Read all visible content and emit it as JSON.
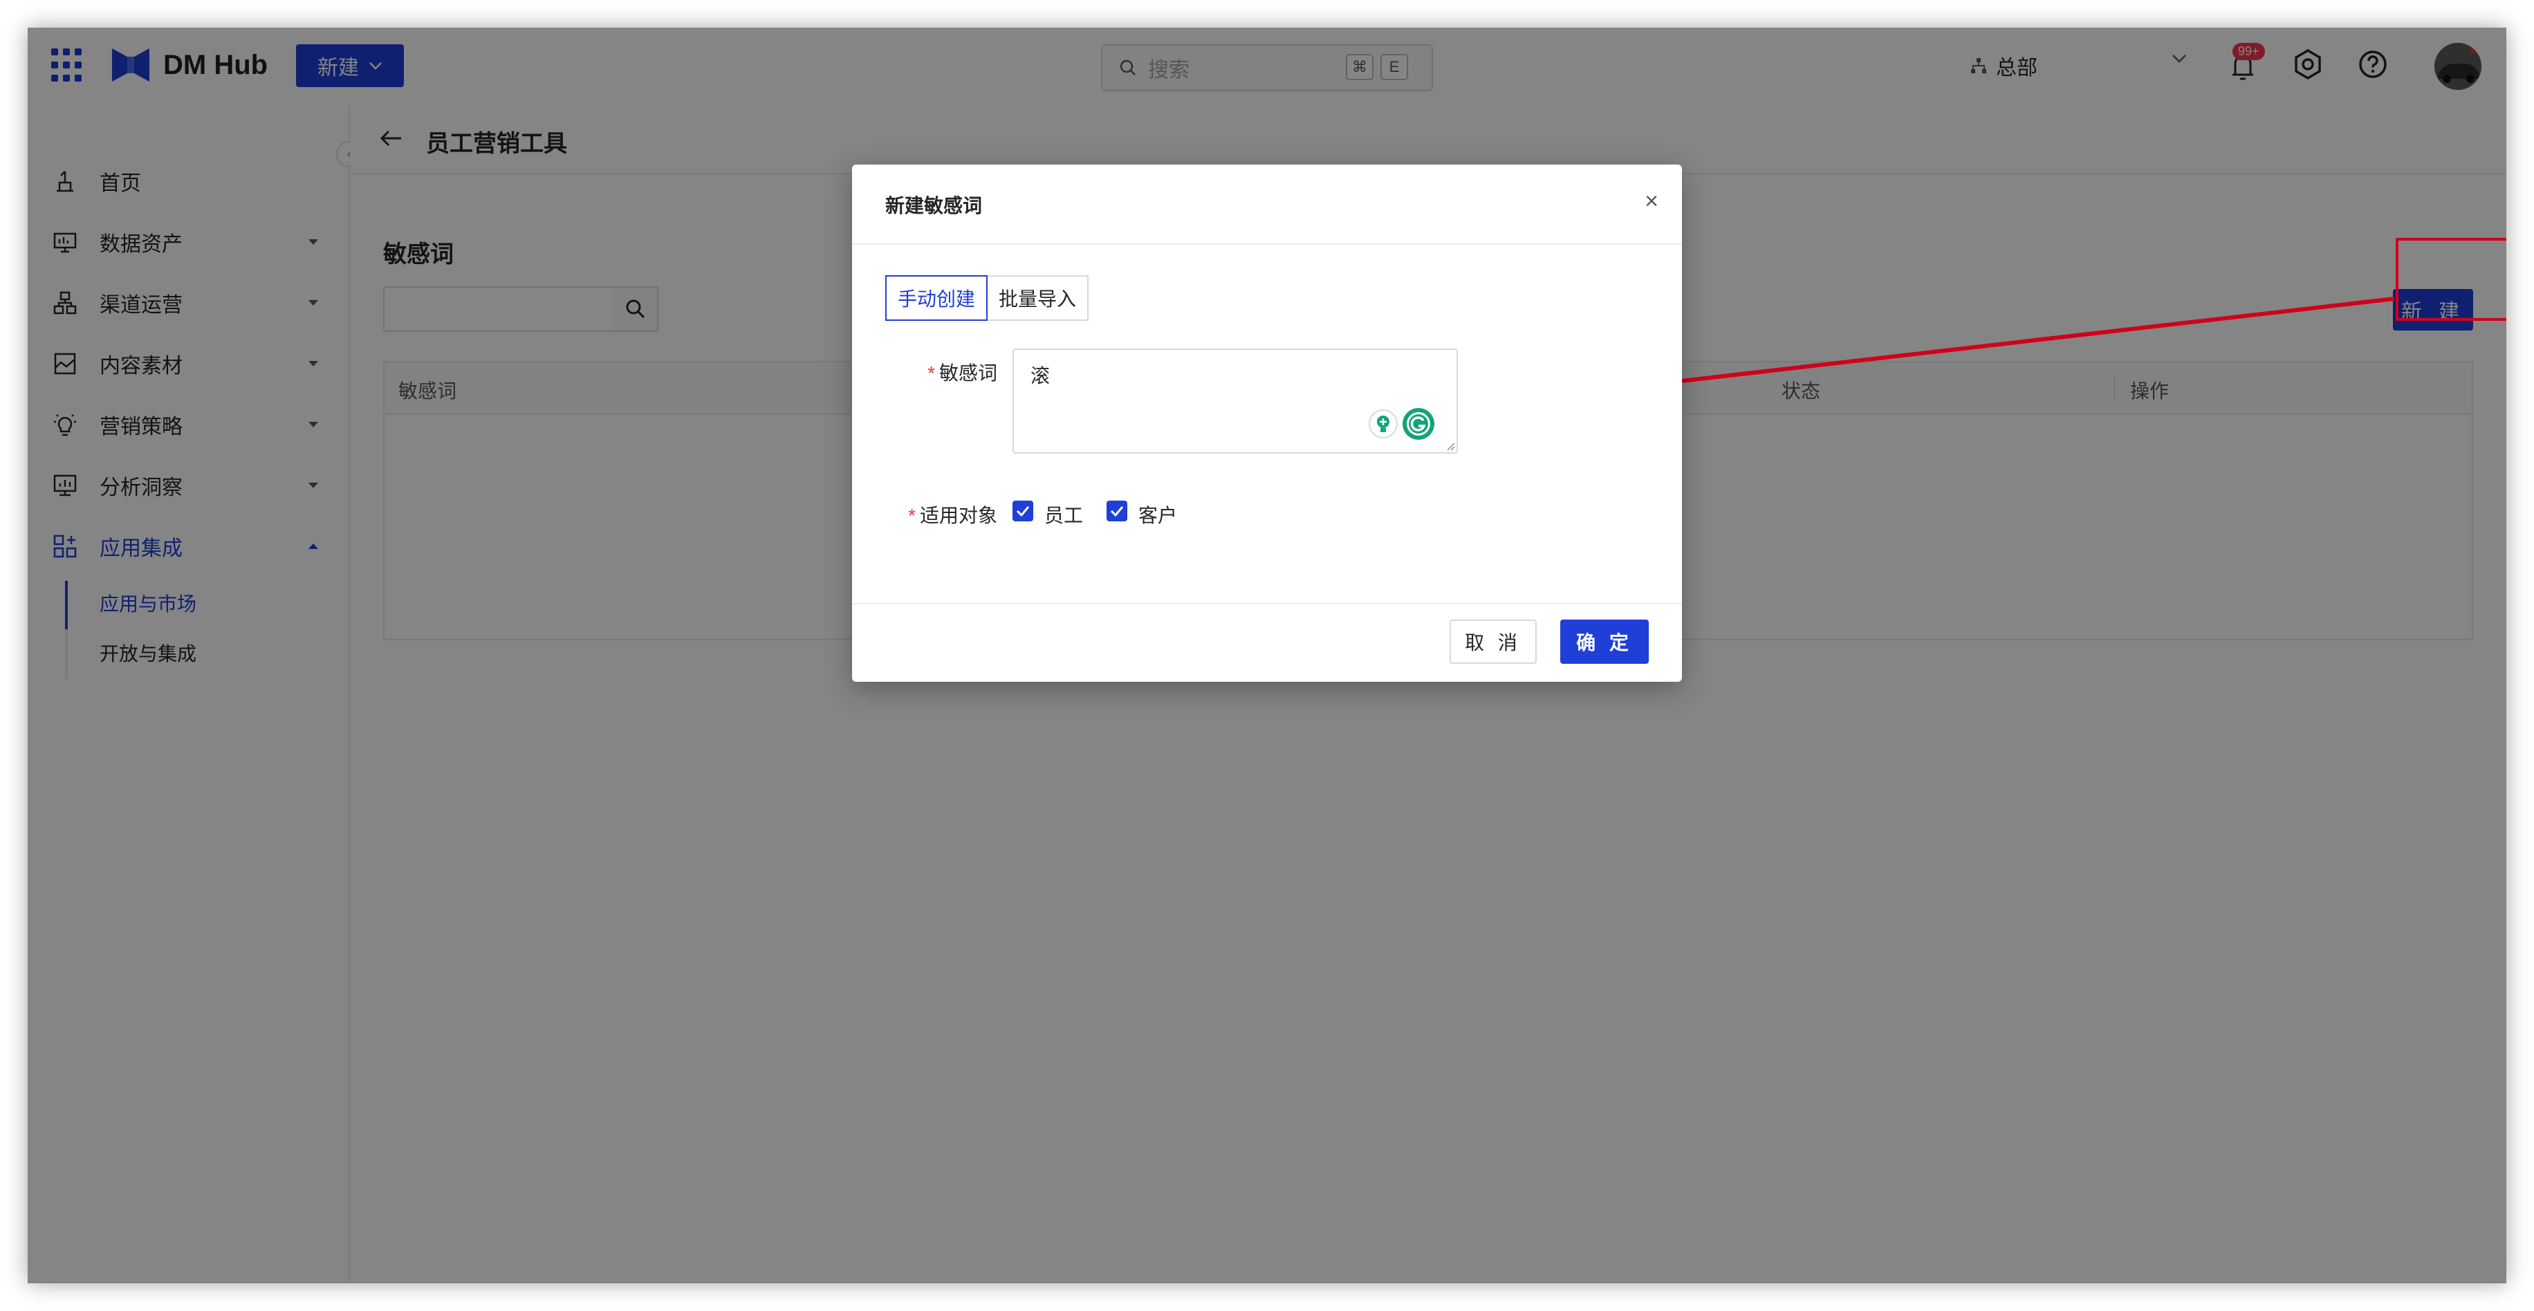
{
  "app": {
    "brand": "DM Hub",
    "new_menu_label": "新建"
  },
  "search": {
    "placeholder": "搜索",
    "shortcut_key1": "⌘",
    "shortcut_key2": "E"
  },
  "org": {
    "current": "总部"
  },
  "notifications": {
    "count": "99+"
  },
  "sidebar": {
    "items": [
      {
        "label": "首页",
        "icon": "home-icon"
      },
      {
        "label": "数据资产",
        "icon": "data-asset-icon"
      },
      {
        "label": "渠道运营",
        "icon": "channel-icon"
      },
      {
        "label": "内容素材",
        "icon": "content-icon"
      },
      {
        "label": "营销策略",
        "icon": "strategy-icon"
      },
      {
        "label": "分析洞察",
        "icon": "analytics-icon"
      },
      {
        "label": "应用集成",
        "icon": "apps-icon"
      }
    ],
    "sub_items": [
      {
        "label": "应用与市场"
      },
      {
        "label": "开放与集成"
      }
    ]
  },
  "page": {
    "title": "员工营销工具",
    "section_title": "敏感词",
    "new_button": "新 建",
    "table_headers": [
      "敏感词",
      "状态",
      "操作"
    ]
  },
  "modal": {
    "title": "新建敏感词",
    "tabs": [
      "手动创建",
      "批量导入"
    ],
    "field_word_label": "敏感词",
    "field_word_value": "滚",
    "field_scope_label": "适用对象",
    "scope_options": [
      "员工",
      "客户"
    ],
    "cancel": "取 消",
    "ok": "确 定"
  },
  "colors": {
    "primary": "#1f3fd7",
    "annotation": "#d0021b",
    "required": "#e53935"
  }
}
